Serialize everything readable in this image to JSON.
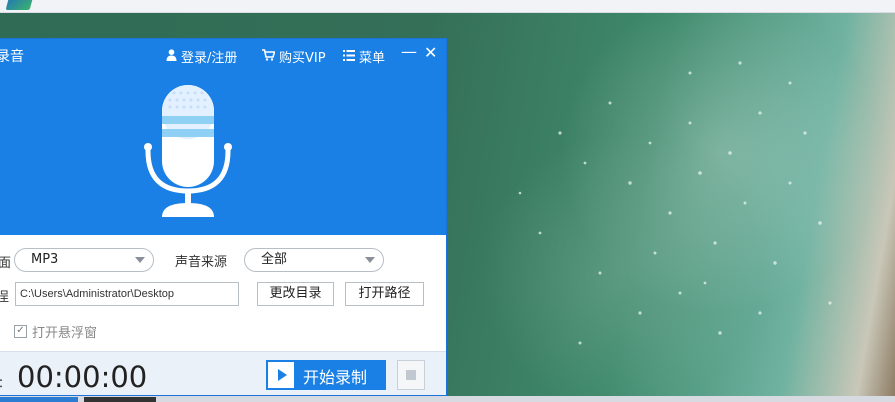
{
  "window": {
    "title": "录音",
    "login_label": "登录/注册",
    "vip_label": "购买VIP",
    "menu_label": "菜单",
    "minimize_glyph": "—",
    "close_glyph": "✕"
  },
  "icons": {
    "user": "user-icon",
    "cart": "cart-icon",
    "menu": "menu-icon",
    "mic": "microphone-icon"
  },
  "settings": {
    "format_label_fragment": "面",
    "format_value": "MP3",
    "source_label": "声音来源",
    "source_value": "全部",
    "path_label_fragment": "浧",
    "path_value": "C:\\Users\\Administrator\\Desktop",
    "change_dir_label": "更改目录",
    "open_path_label": "打开路径",
    "floating_window_label": "打开悬浮窗",
    "floating_window_checked": true
  },
  "recorder": {
    "time_label_fragment": "：",
    "elapsed": "00:00:00",
    "start_label": "开始录制"
  },
  "colors": {
    "accent": "#1a80e5",
    "bottom_bar": "#eaf1f9"
  }
}
